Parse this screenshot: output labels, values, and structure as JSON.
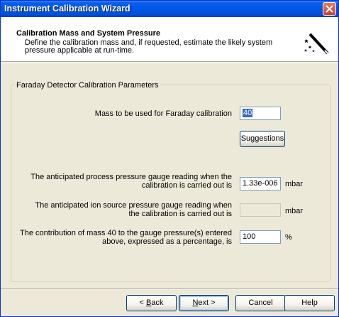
{
  "window": {
    "title": "Instrument Calibration Wizard"
  },
  "header": {
    "title": "Calibration Mass and System Pressure",
    "description": "Define the calibration mass and, if requested, estimate the likely system pressure applicable at run-time."
  },
  "group": {
    "legend": "Faraday Detector Calibration Parameters",
    "mass_label": "Mass to be used for Faraday calibration",
    "mass_value": "40",
    "suggestions_label": "Suggestions",
    "process_pressure_label_1": "The anticipated process pressure gauge reading when the",
    "process_pressure_label_2": "calibration is carried out is",
    "process_pressure_value": "1.33e-006",
    "process_pressure_unit": "mbar",
    "ion_pressure_label_1": "The anticipated ion source pressure gauge reading when",
    "ion_pressure_label_2": "the calibration is carried out is",
    "ion_pressure_value": "",
    "ion_pressure_unit": "mbar",
    "contribution_label_1": "The contribution of mass 40 to the gauge pressure(s) entered",
    "contribution_label_2": "above, expressed as a percentage, is",
    "contribution_value": "100",
    "contribution_unit": "%"
  },
  "buttons": {
    "back_prefix": "< ",
    "back_key": "B",
    "back_rest": "ack",
    "next_key": "N",
    "next_rest": "ext >",
    "cancel": "Cancel",
    "help": "Help"
  },
  "icons": {
    "close": "close-icon",
    "wizard": "magic-wand-icon"
  },
  "colors": {
    "title_bar": "#0055e5",
    "dialog_bg": "#ece9d8",
    "selection": "#316ac5"
  }
}
